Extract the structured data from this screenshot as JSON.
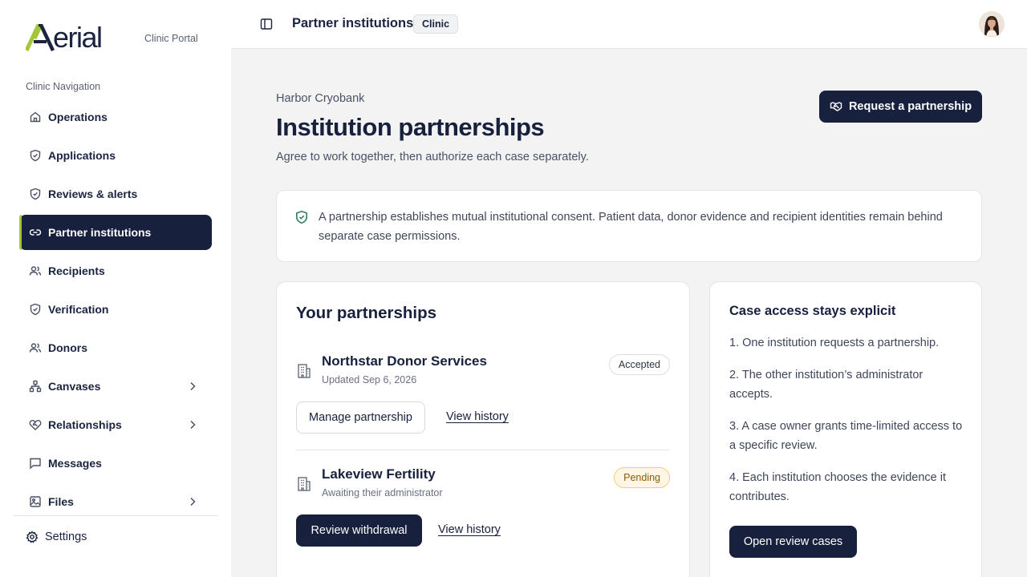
{
  "brand": {
    "logo_text": "erial",
    "portal": "Clinic Portal"
  },
  "sidebar": {
    "heading": "Clinic Navigation",
    "items": [
      {
        "label": "Operations",
        "icon": "home-icon"
      },
      {
        "label": "Applications",
        "icon": "shield-check-icon"
      },
      {
        "label": "Reviews & alerts",
        "icon": "shield-check-icon"
      },
      {
        "label": "Partner institutions",
        "icon": "link-icon",
        "active": true
      },
      {
        "label": "Recipients",
        "icon": "users-icon"
      },
      {
        "label": "Verification",
        "icon": "shield-check-icon"
      },
      {
        "label": "Donors",
        "icon": "users-icon"
      },
      {
        "label": "Canvases",
        "icon": "network-icon",
        "expandable": true
      },
      {
        "label": "Relationships",
        "icon": "heart-handshake-icon",
        "expandable": true
      },
      {
        "label": "Messages",
        "icon": "message-icon"
      },
      {
        "label": "Files",
        "icon": "image-icon",
        "expandable": true
      }
    ],
    "settings_label": "Settings"
  },
  "topbar": {
    "title": "Partner institutions",
    "badge": "Clinic"
  },
  "main": {
    "org_name": "Harbor Cryobank",
    "title": "Institution partnerships",
    "subtitle": "Agree to work together, then authorize each case separately.",
    "request_button": "Request a partnership",
    "notice": "A partnership establishes mutual institutional consent. Patient data, donor evidence and recipient identities remain behind separate case permissions."
  },
  "partnerships": {
    "title": "Your partnerships",
    "items": [
      {
        "name": "Northstar Donor Services",
        "meta": "Updated Sep 6, 2026",
        "status": "Accepted",
        "primary_action": "Manage partnership",
        "secondary_action": "View history"
      },
      {
        "name": "Lakeview Fertility",
        "meta": "Awaiting their administrator",
        "status": "Pending",
        "primary_action": "Review withdrawal",
        "secondary_action": "View history"
      }
    ]
  },
  "access": {
    "title": "Case access stays explicit",
    "steps": [
      "1. One institution requests a partnership.",
      "2. The other institution’s administrator accepts.",
      "3. A case owner grants time-limited access to a specific review.",
      "4. Each institution chooses the evidence it contributes."
    ],
    "button": "Open review cases"
  },
  "colors": {
    "navy": "#17203d",
    "accent_green": "#a6c63a",
    "shield_green": "#2e7d5b",
    "pending_bg": "#fdf6e6",
    "pending_border": "#efcf77",
    "pending_text": "#8a5a06"
  }
}
